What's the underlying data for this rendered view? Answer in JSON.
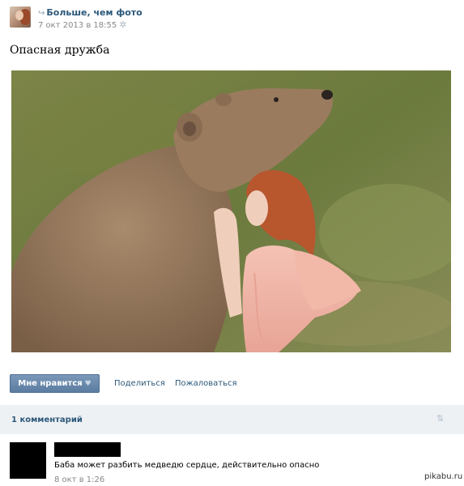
{
  "post": {
    "author": "Больше, чем фото",
    "time": "7 окт 2013 в 18:55",
    "title": "Опасная дружба"
  },
  "actions": {
    "like": "Мне нравится",
    "share": "Поделиться",
    "report": "Пожаловаться"
  },
  "comments": {
    "count_label": "1 комментарий",
    "items": [
      {
        "text": "Баба может разбить медведю сердце, действительно опасно",
        "date": "8 окт в 1:26"
      }
    ]
  },
  "watermark": "pikabu.ru",
  "icons": {
    "repost": "repost-icon",
    "settings": "gear-icon",
    "heart": "heart-icon",
    "sort": "sort-arrow-icon"
  },
  "colors": {
    "link": "#2b587a",
    "button": "#5b7da1",
    "meta": "#888888",
    "comments_bar": "#eef1f4"
  }
}
